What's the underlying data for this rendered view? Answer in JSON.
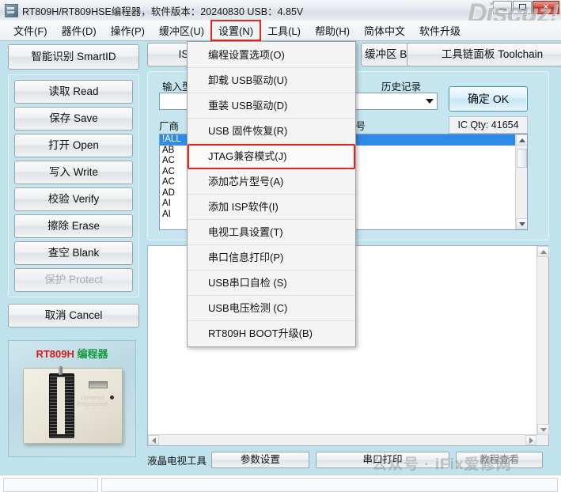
{
  "window": {
    "title": "RT809H/RT809HSE编程器，软件版本：20240830  USB：4.85V",
    "minimize_label": "",
    "maximize_label": "",
    "close_label": "✕",
    "watermark": "Discuz!"
  },
  "menubar": {
    "items": [
      {
        "label": "文件(F)",
        "open": false
      },
      {
        "label": "器件(D)",
        "open": false
      },
      {
        "label": "操作(P)",
        "open": false
      },
      {
        "label": "缓冲区(U)",
        "open": false
      },
      {
        "label": "设置(N)",
        "open": true
      },
      {
        "label": "工具(L)",
        "open": false
      },
      {
        "label": "帮助(H)",
        "open": false
      },
      {
        "label": "简体中文",
        "open": false
      },
      {
        "label": "软件升级",
        "open": false
      }
    ]
  },
  "dropdown": {
    "parent": "设置(N)",
    "highlight_color": "#e8251a",
    "items": [
      {
        "label": "编程设置选项(O)",
        "highlighted": false
      },
      {
        "label": "卸载 USB驱动(U)",
        "highlighted": false
      },
      {
        "label": "重装 USB驱动(D)",
        "highlighted": false
      },
      {
        "label": "USB 固件恢复(R)",
        "highlighted": false
      },
      {
        "label": "JTAG兼容模式(J)",
        "highlighted": true
      },
      {
        "label": "添加芯片型号(A)",
        "highlighted": false
      },
      {
        "label": "添加 ISP软件(I)",
        "highlighted": false
      },
      {
        "label": "电视工具设置(T)",
        "highlighted": false
      },
      {
        "label": "串口信息打印(P)",
        "highlighted": false
      },
      {
        "label": "USB串口自检 (S)",
        "highlighted": false
      },
      {
        "label": "USB电压检测 (C)",
        "highlighted": false
      },
      {
        "label": "RT809H BOOT升级(B)",
        "highlighted": false
      }
    ]
  },
  "sidebar": {
    "smart_id": "智能识别 SmartID",
    "operations": [
      {
        "label": "读取 Read",
        "disabled": false
      },
      {
        "label": "保存 Save",
        "disabled": false
      },
      {
        "label": "打开 Open",
        "disabled": false
      },
      {
        "label": "写入 Write",
        "disabled": false
      },
      {
        "label": "校验 Verify",
        "disabled": false
      },
      {
        "label": "擦除 Erase",
        "disabled": false
      },
      {
        "label": "查空 Blank",
        "disabled": false
      },
      {
        "label": "保护 Protect",
        "disabled": true
      }
    ],
    "cancel": "取消 Cancel",
    "device_image": {
      "title_model": "RT809H",
      "title_cn": "编程器",
      "body_text": "Universal Programmer"
    }
  },
  "toolbar": {
    "isp_button": "ISP软件",
    "buffer_button": "缓冲区 Buffer",
    "toolchain_button": "工具链面板 Toolchain"
  },
  "selector": {
    "input_label": "输入型号",
    "history_label": "历史记录",
    "maker_label": "厂商",
    "model_label": "型号",
    "input_value": "",
    "history_value": "",
    "ok_button": "确定 OK",
    "ic_qty": "IC Qty: 41654",
    "list_rows": [
      {
        "text": "!ALL",
        "selected": true
      },
      {
        "text": "AB",
        "selected": false
      },
      {
        "text": "AC",
        "selected": false
      },
      {
        "text": "AC",
        "selected": false
      },
      {
        "text": "AC",
        "selected": false
      },
      {
        "text": "AD",
        "selected": false
      },
      {
        "text": "AI",
        "selected": false
      },
      {
        "text": "AI",
        "selected": false
      }
    ]
  },
  "bottombar": {
    "tv_tool_label": "液晶电视工具",
    "param_button": "参数设置",
    "serial_print_button": "串口打印",
    "tutorial_button": "教程查看"
  },
  "watermark_bottom": {
    "text": "公众号 · iFix爱修网"
  },
  "colors": {
    "panel_background": "#bfe2ec",
    "selection_blue": "#2f8ae8",
    "highlight_red": "#e8251a",
    "title_gradient_top": "#f4f6f8"
  }
}
